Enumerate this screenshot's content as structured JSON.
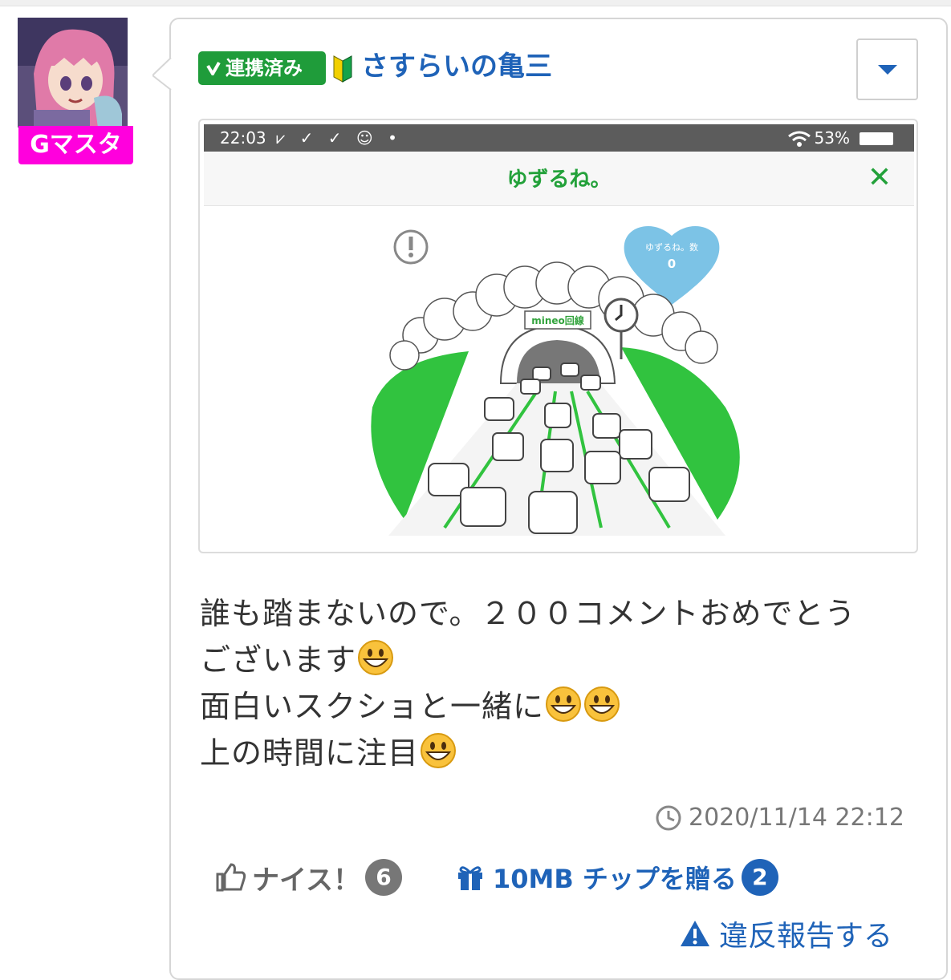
{
  "user": {
    "rank": "Gマスター",
    "linked_label": "連携済み",
    "name": "さすらいの亀三"
  },
  "post": {
    "screenshot": {
      "status_time": "22:03",
      "status_icons": "⩗ ✓ ✓ ☺ •",
      "battery": "53%",
      "app_title": "ゆずるね。",
      "close_label": "✕",
      "heart_label": "ゆずるね。数",
      "heart_count": "0",
      "sign_text": "mineo回線"
    },
    "body_lines": [
      "誰も踏まないので。２００コメントおめでとう",
      "ございます",
      "面白いスクショと一緒に",
      "上の時間に注目"
    ],
    "timestamp": "2020/11/14 22:12"
  },
  "actions": {
    "nice_label": "ナイス！",
    "nice_count": "6",
    "tip_label": "10MB チップを贈る",
    "tip_count": "2",
    "report_label": "違反報告する"
  },
  "colors": {
    "brand_green": "#1f9c3a",
    "link_blue": "#1f63b8",
    "rank_magenta": "#ff00dd"
  }
}
